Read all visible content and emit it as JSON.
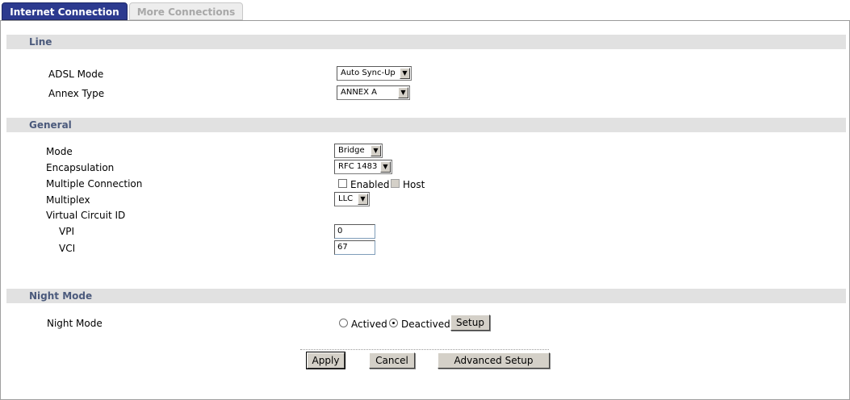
{
  "tabs": {
    "active": "Internet Connection",
    "inactive": "More Connections"
  },
  "line": {
    "title": "Line",
    "adsl_mode": {
      "label": "ADSL Mode",
      "value": "Auto Sync-Up"
    },
    "annex_type": {
      "label": "Annex Type",
      "value": "ANNEX A"
    }
  },
  "general": {
    "title": "General",
    "mode": {
      "label": "Mode",
      "value": "Bridge"
    },
    "encapsulation": {
      "label": "Encapsulation",
      "value": "RFC 1483"
    },
    "multiple_connection": {
      "label": "Multiple Connection",
      "enabled_label": "Enabled",
      "host_label": "Host"
    },
    "multiplex": {
      "label": "Multiplex",
      "value": "LLC"
    },
    "vcid": {
      "label": "Virtual Circuit ID"
    },
    "vpi": {
      "label": "VPI",
      "value": "0"
    },
    "vci": {
      "label": "VCI",
      "value": "67"
    }
  },
  "night": {
    "title": "Night Mode",
    "label": "Night Mode",
    "actived_label": "Actived",
    "deactived_label": "Deactived",
    "setup_label": "Setup"
  },
  "actions": {
    "apply": "Apply",
    "cancel": "Cancel",
    "advanced": "Advanced Setup"
  }
}
